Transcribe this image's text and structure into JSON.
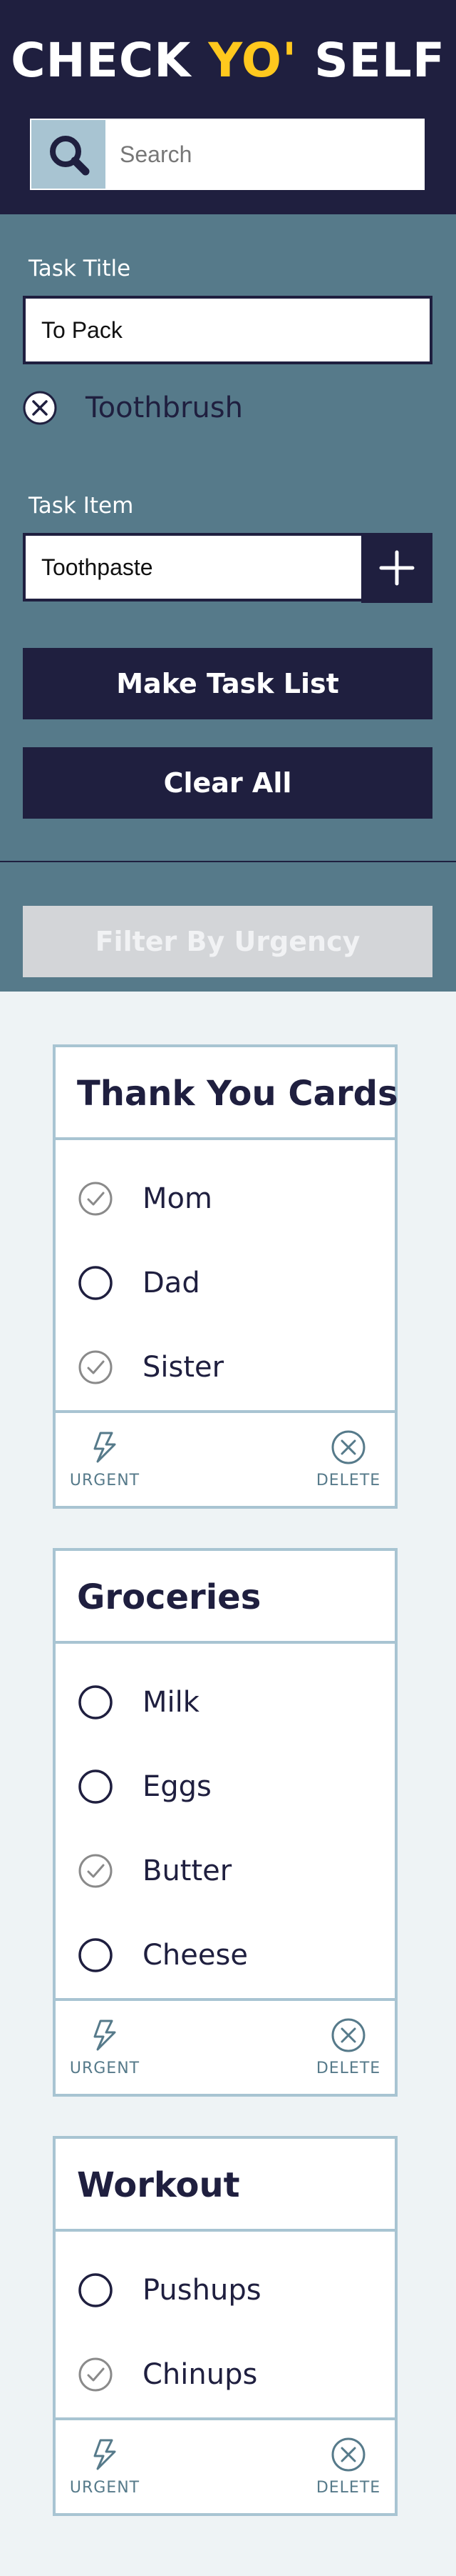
{
  "header": {
    "logo_part1": "CHECK ",
    "logo_accent": "YO'",
    "logo_part2": " SELF",
    "search_placeholder": "Search",
    "search_icon": "magnifier-icon"
  },
  "form": {
    "title_label": "Task Title",
    "title_value": "To Pack",
    "pending_item": "Toothbrush",
    "item_label": "Task Item",
    "item_value": "Toothpaste",
    "make_button": "Make Task List",
    "clear_button": "Clear All",
    "filter_button": "Filter By Urgency"
  },
  "colors": {
    "navy": "#1f1f3f",
    "slate": "#567a8a",
    "light_blue": "#a8c4d2",
    "yellow": "#ffc81e",
    "page_bg": "#eef3f5"
  },
  "cards": [
    {
      "title": "Thank You Cards",
      "items": [
        {
          "text": "Mom",
          "checked": true
        },
        {
          "text": "Dad",
          "checked": false
        },
        {
          "text": "Sister",
          "checked": true
        }
      ],
      "urgent_label": "URGENT",
      "delete_label": "DELETE"
    },
    {
      "title": "Groceries",
      "items": [
        {
          "text": "Milk",
          "checked": false
        },
        {
          "text": "Eggs",
          "checked": false
        },
        {
          "text": "Butter",
          "checked": true
        },
        {
          "text": "Cheese",
          "checked": false
        }
      ],
      "urgent_label": "URGENT",
      "delete_label": "DELETE"
    },
    {
      "title": "Workout",
      "items": [
        {
          "text": "Pushups",
          "checked": false
        },
        {
          "text": "Chinups",
          "checked": true
        }
      ],
      "urgent_label": "URGENT",
      "delete_label": "DELETE"
    }
  ]
}
